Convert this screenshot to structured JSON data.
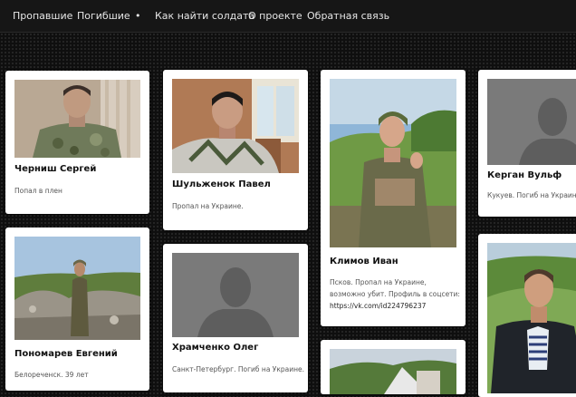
{
  "nav": {
    "items": [
      "Пропавшие",
      "Погибшие",
      "•",
      "Как найти солдата",
      "О проекте",
      "Обратная связь"
    ]
  },
  "cards": [
    {
      "name": "Черниш Сергей",
      "desc": [
        "Попал в плен"
      ]
    },
    {
      "name": "Шульженок Павел",
      "desc": [
        "Пропал на Украине."
      ]
    },
    {
      "name": "Климов Иван",
      "desc": [
        "Псков. Пропал на Украине,",
        "возможно убит. Профиль в соцсети:",
        "https://vk.com/id224796237"
      ]
    },
    {
      "name": "Керган Вульф",
      "desc": [
        "Кукуев. Погиб на Украине."
      ]
    },
    {
      "name": "Пономарев Евгений",
      "desc": [
        "Белореченск. 39 лет"
      ]
    },
    {
      "name": "Храмченко Олег",
      "desc": [
        "Санкт-Петербург. Погиб на Украине."
      ]
    }
  ],
  "colors": {
    "nav_bg": "#161616",
    "nav_text": "#e6e6e6",
    "card_bg": "#ffffff",
    "placeholder_bg": "#7a7a7a",
    "placeholder_figure": "#5e5e5e"
  }
}
